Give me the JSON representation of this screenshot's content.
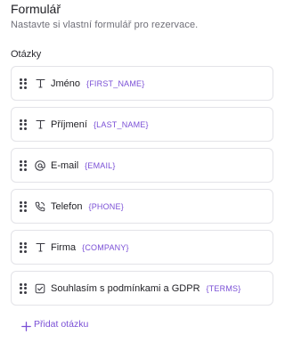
{
  "header": {
    "title": "Formulář",
    "subtitle": "Nastavte si vlastní formulář pro rezervace."
  },
  "questions_section": {
    "label": "Otázky",
    "items": [
      {
        "label": "Jméno",
        "token": "{FIRST_NAME}",
        "icon": "text-icon"
      },
      {
        "label": "Příjmení",
        "token": "{LAST_NAME}",
        "icon": "text-icon"
      },
      {
        "label": "E-mail",
        "token": "{EMAIL}",
        "icon": "at-icon"
      },
      {
        "label": "Telefon",
        "token": "{PHONE}",
        "icon": "phone-icon"
      },
      {
        "label": "Firma",
        "token": "{COMPANY}",
        "icon": "text-icon"
      },
      {
        "label": "Souhlasím s podmínkami a GDPR",
        "token": "{TERMS}",
        "icon": "checkbox-icon"
      }
    ]
  },
  "actions": {
    "add_question_label": "Přidat otázku"
  },
  "colors": {
    "accent": "#7a4fd6",
    "border": "#e3e3e8",
    "muted_text": "#6f6f78"
  }
}
